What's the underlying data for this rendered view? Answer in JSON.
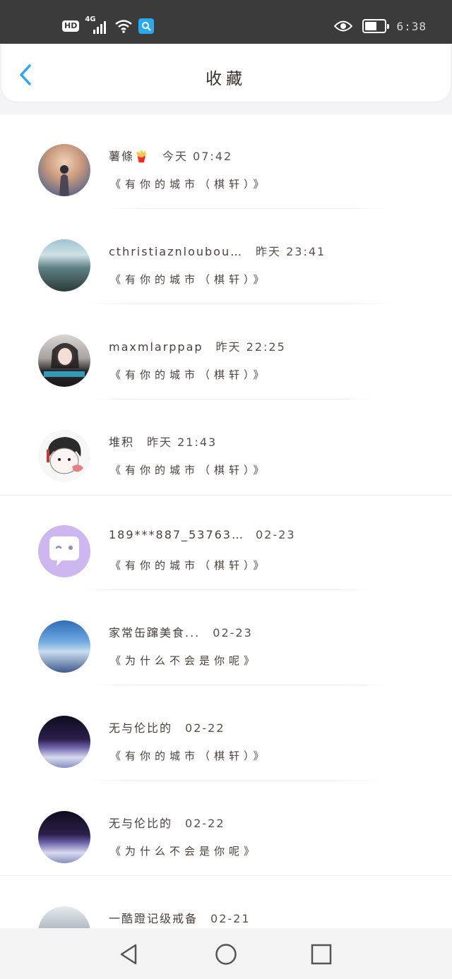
{
  "status_bar": {
    "hd_label": "HD",
    "network_label": "4G",
    "clock": "6:38",
    "battery_level": 0.6
  },
  "header": {
    "title": "收藏"
  },
  "list": {
    "items": [
      {
        "name": "薯條🍟",
        "time": "今天 07:42",
        "song": "《有你的城市（棋轩）》"
      },
      {
        "name": "cthristiaznlouboutin",
        "time": "昨天 23:41",
        "song": "《有你的城市（棋轩）》"
      },
      {
        "name": "maxmlarppap",
        "time": "昨天 22:25",
        "song": "《有你的城市（棋轩）》"
      },
      {
        "name": "堆积",
        "time": "昨天 21:43",
        "song": "《有你的城市（棋轩）》"
      },
      {
        "name": "189***887_53763...",
        "time": "02-23",
        "song": "《有你的城市（棋轩）》"
      },
      {
        "name": "家常缶蹿美食...",
        "time": "02-23",
        "song": "《为什么不会是你呢》"
      },
      {
        "name": "无与伦比的",
        "time": "02-22",
        "song": "《有你的城市（棋轩）》"
      },
      {
        "name": "无与伦比的",
        "time": "02-22",
        "song": "《为什么不会是你呢》"
      },
      {
        "name": "一酷蹬记级戒备",
        "time": "02-21",
        "song": ""
      }
    ]
  },
  "icons": {
    "back": "chevron-left-icon",
    "nav_back": "triangle-back-icon",
    "nav_home": "circle-home-icon",
    "nav_recent": "square-recent-icon"
  },
  "colors": {
    "accent": "#2aa8f0",
    "status_bar": "#3b3b3b",
    "text": "#4a3f3a"
  }
}
